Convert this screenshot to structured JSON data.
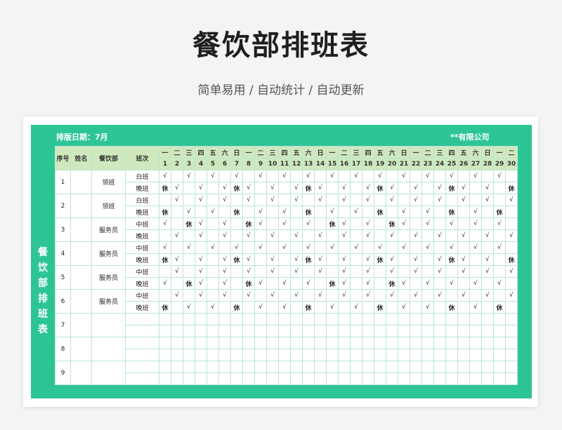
{
  "header": {
    "title": "餐饮部排班表",
    "subtitle": "简单易用  /  自动统计  /  自动更新"
  },
  "sheet": {
    "date_label": "排版日期：7月",
    "company": "**有限公司",
    "side_title": "餐饮部排班表"
  },
  "columns": {
    "no": "序号",
    "name": "姓名",
    "dept": "餐饮部",
    "shift": "班次"
  },
  "weekdays": [
    "一",
    "二",
    "三",
    "四",
    "五",
    "六",
    "日",
    "一",
    "二",
    "三",
    "四",
    "五",
    "六",
    "日",
    "一",
    "二",
    "三",
    "四",
    "五",
    "六",
    "日",
    "一",
    "二",
    "三",
    "四",
    "五",
    "六",
    "日",
    "一",
    "二"
  ],
  "days": [
    "1",
    "2",
    "3",
    "4",
    "5",
    "6",
    "7",
    "8",
    "9",
    "10",
    "11",
    "12",
    "13",
    "14",
    "15",
    "16",
    "17",
    "18",
    "19",
    "20",
    "21",
    "22",
    "23",
    "24",
    "25",
    "26",
    "27",
    "28",
    "29",
    "30"
  ],
  "marks": {
    "work": "√",
    "rest": "休"
  },
  "employees": [
    {
      "no": "1",
      "name": "",
      "dept": "领班",
      "shifts": [
        {
          "label": "白班",
          "pattern": "101010101010101010101010101010"
        },
        {
          "label": "晚班",
          "pattern": "210101210101210101210101210102"
        }
      ]
    },
    {
      "no": "2",
      "name": "",
      "dept": "领班",
      "shifts": [
        {
          "label": "白班",
          "pattern": "010101010101010101010101010101"
        },
        {
          "label": "晚班",
          "pattern": "201010201010201010201010201020"
        }
      ]
    },
    {
      "no": "3",
      "name": "",
      "dept": "服务员",
      "shifts": [
        {
          "label": "中班",
          "pattern": "102101021010102101021010101010"
        },
        {
          "label": "晚班",
          "pattern": "010101010101010101010101010101"
        }
      ]
    },
    {
      "no": "4",
      "name": "",
      "dept": "服务员",
      "shifts": [
        {
          "label": "中班",
          "pattern": "101010101010101010101010101010"
        },
        {
          "label": "晚班",
          "pattern": "210101210101210101210101210102"
        }
      ]
    },
    {
      "no": "5",
      "name": "",
      "dept": "服务员",
      "shifts": [
        {
          "label": "中班",
          "pattern": "010101010101010101010101010101"
        },
        {
          "label": "晚班",
          "pattern": "102101021010102101021010101010"
        }
      ]
    },
    {
      "no": "6",
      "name": "",
      "dept": "服务员",
      "shifts": [
        {
          "label": "中班",
          "pattern": "010101010101010101010101010101"
        },
        {
          "label": "晚班",
          "pattern": "201010201010201010201010201020"
        }
      ]
    },
    {
      "no": "7",
      "name": "",
      "dept": "",
      "shifts": [
        {
          "label": "",
          "pattern": ""
        },
        {
          "label": "",
          "pattern": ""
        }
      ]
    },
    {
      "no": "8",
      "name": "",
      "dept": "",
      "shifts": [
        {
          "label": "",
          "pattern": ""
        },
        {
          "label": "",
          "pattern": ""
        }
      ]
    },
    {
      "no": "9",
      "name": "",
      "dept": "",
      "shifts": [
        {
          "label": "",
          "pattern": ""
        },
        {
          "label": "",
          "pattern": ""
        }
      ]
    }
  ]
}
